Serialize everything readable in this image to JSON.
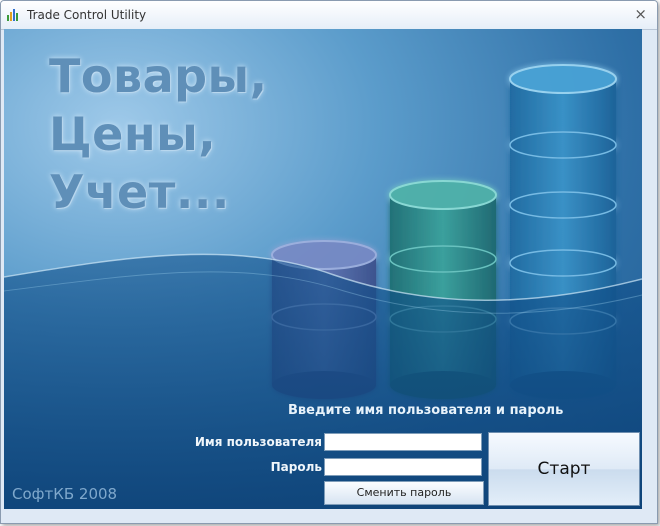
{
  "window": {
    "title": "Trade Control Utility",
    "close_glyph": "×",
    "icon": "bar-chart-icon"
  },
  "slogan": {
    "line1": "Товары,",
    "line2": "Цены,",
    "line3": "Учет..."
  },
  "login": {
    "prompt": "Введите имя пользователя и пароль",
    "username_label": "Имя пользователя",
    "username_value": "",
    "password_label": "Пароль",
    "password_value": "",
    "change_password_label": "Сменить пароль",
    "start_label": "Старт"
  },
  "footer": {
    "copyright": "СофтКБ 2008"
  },
  "colors": {
    "purple_stack": "#5a6aa8",
    "green_stack": "#2f8f8a",
    "blue_stack": "#2a7fb8"
  }
}
